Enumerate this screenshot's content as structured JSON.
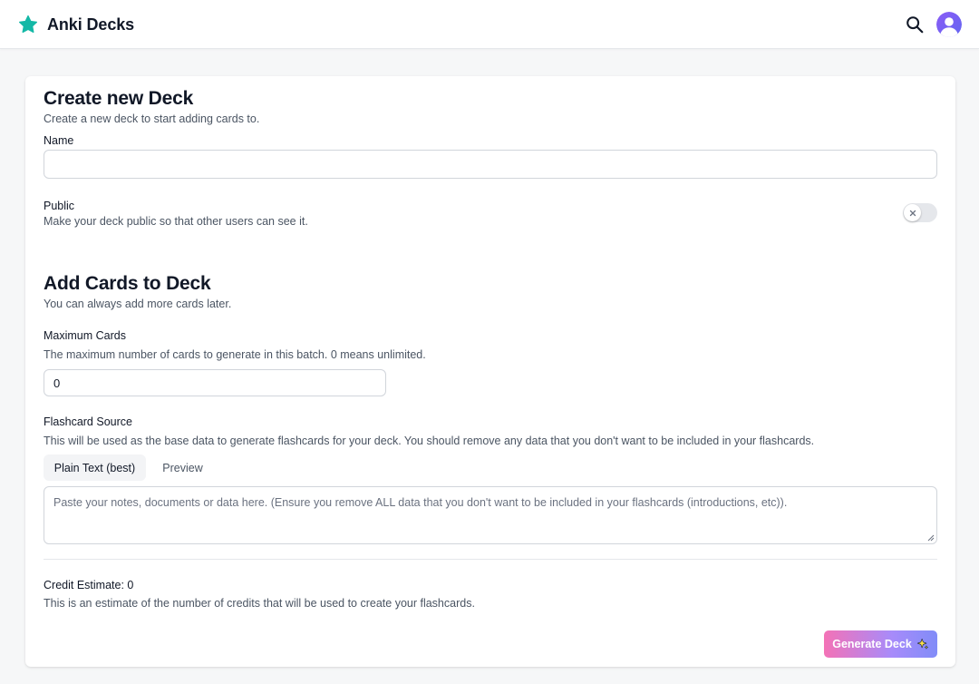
{
  "header": {
    "brand": "Anki Decks",
    "logo_icon": "star-icon",
    "accent_color": "#14b8a6",
    "search_icon": "search-icon",
    "avatar_icon": "user-avatar-icon",
    "avatar_color": "#6366f1"
  },
  "create_deck": {
    "title": "Create new Deck",
    "subtitle": "Create a new deck to start adding cards to.",
    "name_label": "Name",
    "name_value": "",
    "public_label": "Public",
    "public_hint": "Make your deck public so that other users can see it.",
    "public_enabled": false
  },
  "add_cards": {
    "title": "Add Cards to Deck",
    "subtitle": "You can always add more cards later.",
    "max_cards_label": "Maximum Cards",
    "max_cards_hint": "The maximum number of cards to generate in this batch. 0 means unlimited.",
    "max_cards_value": "0",
    "source_label": "Flashcard Source",
    "source_hint": "This will be used as the base data to generate flashcards for your deck. You should remove any data that you don't want to be included in your flashcards.",
    "tabs": [
      {
        "label": "Plain Text (best)",
        "active": true
      },
      {
        "label": "Preview",
        "active": false
      }
    ],
    "source_placeholder": "Paste your notes, documents or data here. (Ensure you remove ALL data that you don't want to be included in your flashcards (introductions, etc)).",
    "credit_label": "Credit Estimate: 0",
    "credit_hint": "This is an estimate of the number of credits that will be used to create your flashcards.",
    "generate_label": "Generate Deck",
    "generate_icon": "sparkle-icon"
  }
}
